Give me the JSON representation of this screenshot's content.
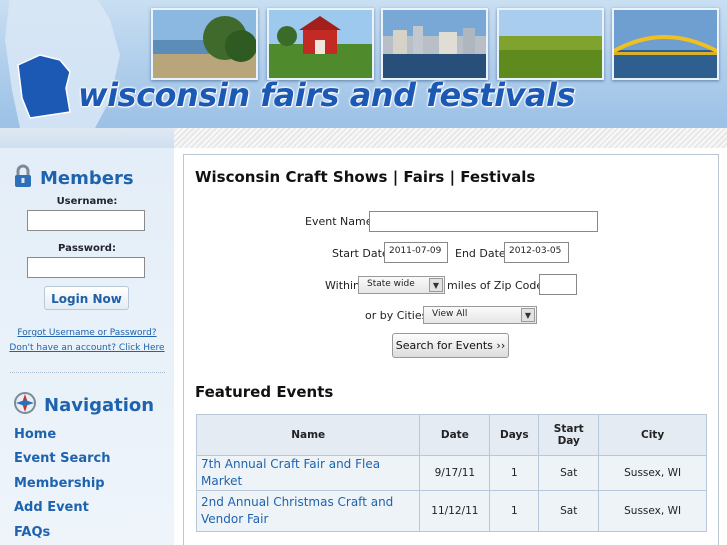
{
  "header": {
    "site_title": "wisconsin fairs and festivals",
    "photos": [
      {
        "name": "lakeshore-photo"
      },
      {
        "name": "red-barn-photo"
      },
      {
        "name": "city-skyline-photo"
      },
      {
        "name": "cornfield-photo"
      },
      {
        "name": "hoan-bridge-photo"
      }
    ]
  },
  "sidebar": {
    "members": {
      "title": "Members",
      "icon": "lock-icon",
      "username_label": "Username:",
      "username_value": "",
      "password_label": "Password:",
      "password_value": "",
      "login_label": "Login Now",
      "forgot_link": "Forgot Username or Password?",
      "signup_link": "Don't have an account? Click Here"
    },
    "navigation": {
      "title": "Navigation",
      "icon": "compass-icon",
      "items": [
        {
          "label": "Home"
        },
        {
          "label": "Event Search"
        },
        {
          "label": "Membership"
        },
        {
          "label": "Add Event"
        },
        {
          "label": "FAQs"
        }
      ]
    }
  },
  "main": {
    "page_title": "Wisconsin Craft Shows | Fairs | Festivals",
    "form": {
      "event_name_label": "Event Name",
      "event_name_value": "",
      "start_date_label": "Start Date",
      "start_date_value": "2011-07-09",
      "end_date_label": "End Date",
      "end_date_value": "2012-03-05",
      "within_label": "Within",
      "within_value": "State wide",
      "zip_label": "miles of Zip Code:",
      "zip_value": "",
      "cities_label": "or by Cities",
      "cities_value": "View All",
      "search_label": "Search for Events ››"
    },
    "featured_title": "Featured Events",
    "table": {
      "headers": {
        "name": "Name",
        "date": "Date",
        "days": "Days",
        "start_day": "Start Day",
        "city": "City"
      },
      "rows": [
        {
          "name": "7th Annual Craft Fair and Flea Market",
          "date": "9/17/11",
          "days": "1",
          "start_day": "Sat",
          "city": "Sussex, WI"
        },
        {
          "name": "2nd Annual Christmas Craft and Vendor Fair",
          "date": "11/12/11",
          "days": "1",
          "start_day": "Sat",
          "city": "Sussex, WI"
        }
      ]
    }
  },
  "colors": {
    "link_blue": "#1e63ae",
    "header_blue": "#b3d0ec",
    "title_blue": "#1c59b5"
  }
}
